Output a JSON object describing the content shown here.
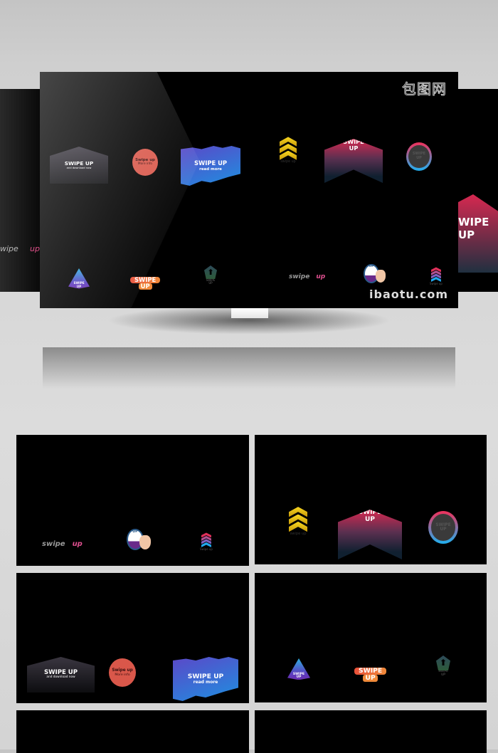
{
  "brand": {
    "logo": "包图网",
    "watermark": "ibaotu.com"
  },
  "stickers": {
    "hex_title": "SWIPE UP",
    "hex_sub": "and download now",
    "circle_title": "Swipe up",
    "circle_sub": "More info",
    "splash_title": "SWIPE UP",
    "splash_sub": "read more",
    "arrow_line1": "SWIPE",
    "arrow_line2": "UP",
    "ring_line1": "SWIPE",
    "ring_line2": "UP",
    "chevron_caption": "swipe up",
    "tri_line1": "SWIPE",
    "tri_line2": "UP",
    "pill_line1": "SWIPE",
    "pill_line2": "UP",
    "pent_caption": "SWIPE UP",
    "text_swipe": "swipe",
    "text_up": "up",
    "hand_label": "UP",
    "stack_caption": "Swipe up"
  },
  "ghost_right": {
    "line1": "WIPE",
    "line2": "UP"
  },
  "ghost_left": {
    "text1": "wipe",
    "text2": "up"
  },
  "colors": {
    "yellow": "#f2c20f",
    "pink": "#e0305a",
    "blue": "#20a8ee",
    "coral": "#d9574a",
    "orange": "#f08a3a"
  }
}
